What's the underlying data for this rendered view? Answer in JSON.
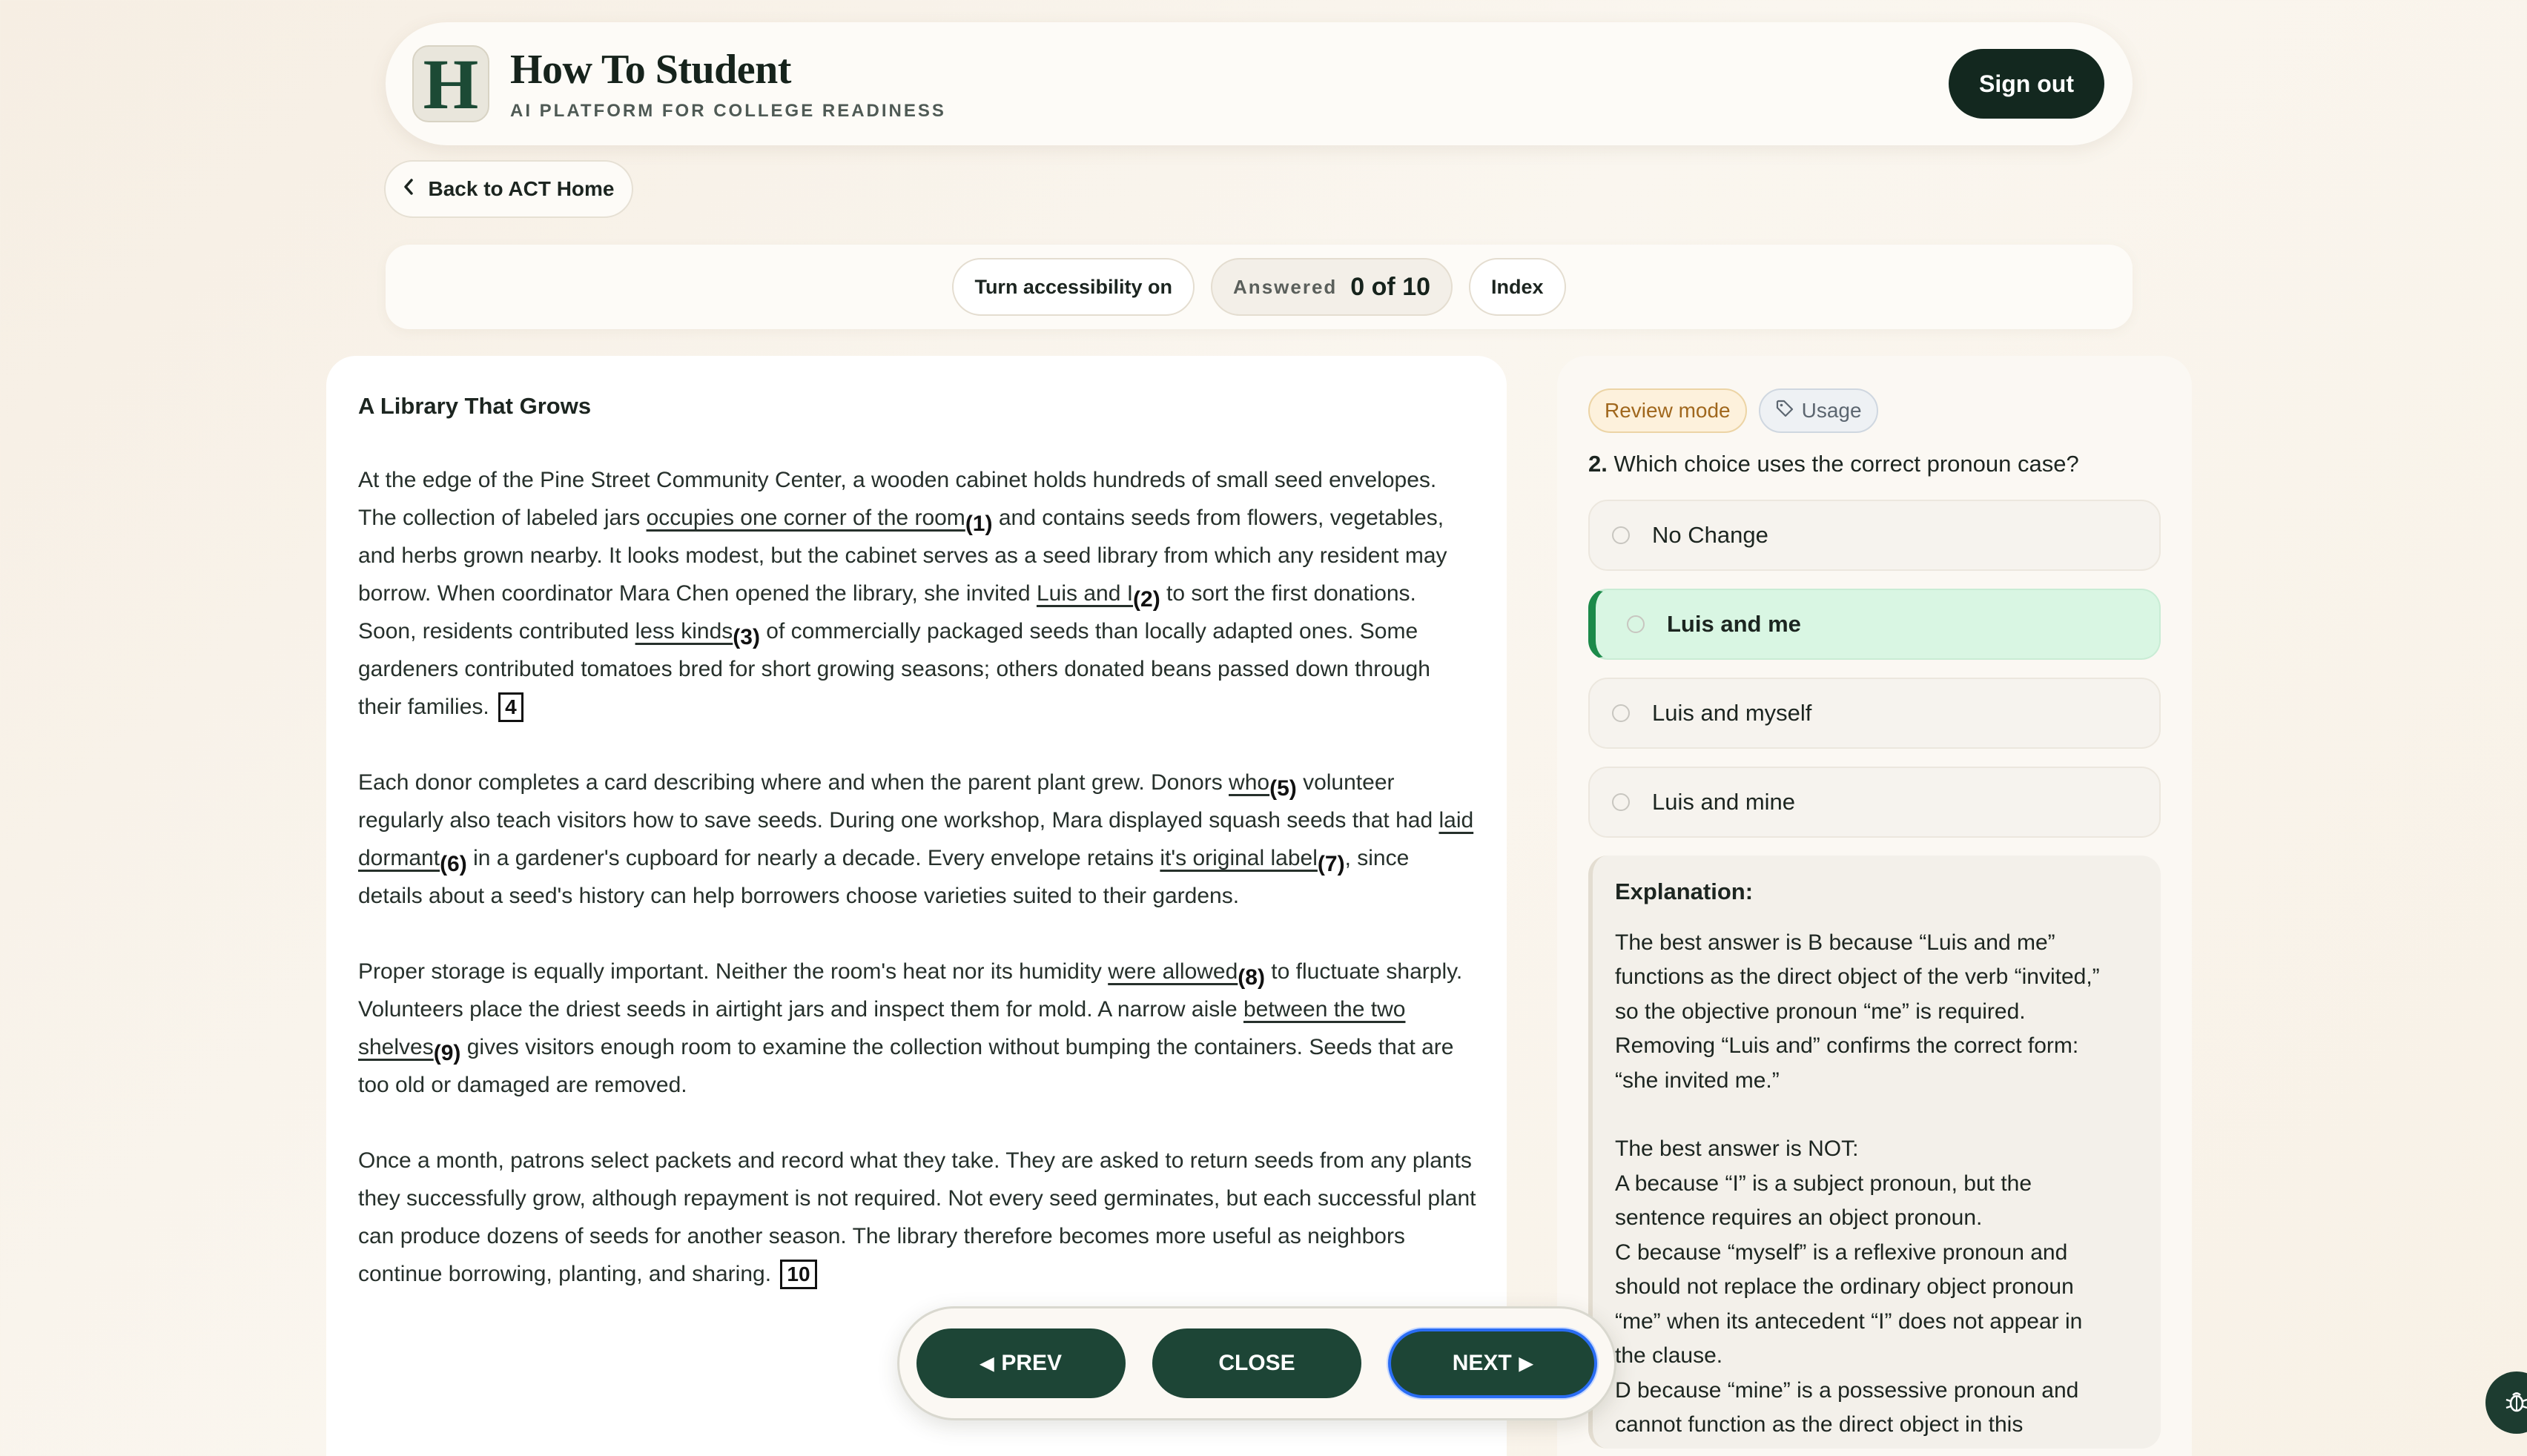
{
  "header": {
    "logo_letter": "H",
    "title": "How To Student",
    "subtitle": "AI PLATFORM FOR COLLEGE READINESS",
    "signout_label": "Sign out"
  },
  "back_button": {
    "label": "Back to ACT Home",
    "icon": "chevron-left-icon"
  },
  "toolbar": {
    "accessibility_label": "Turn accessibility on",
    "answered_label": "Answered",
    "answered_value": "0 of 10",
    "index_label": "Index"
  },
  "passage": {
    "title": "A Library That Grows",
    "paragraphs": [
      [
        {
          "t": "At the edge of the Pine Street Community Center, a wooden cabinet holds hundreds of small seed envelopes. The collection of labeled jars "
        },
        {
          "u": "occupies one corner of the room",
          "n": "(1)"
        },
        {
          "t": " and contains seeds from flowers, vegetables, and herbs grown nearby. It looks modest, but the cabinet serves as a seed library from which any resident may borrow. When coordinator Mara Chen opened the library, she invited "
        },
        {
          "u": "Luis and I",
          "n": "(2)"
        },
        {
          "t": " to sort the first donations. Soon, residents contributed "
        },
        {
          "u": "less kinds",
          "n": "(3)"
        },
        {
          "t": " of commercially packaged seeds than locally adapted ones. Some gardeners contributed tomatoes bred for short growing seasons; others donated beans passed down through their families. "
        },
        {
          "b": "4"
        }
      ],
      [
        {
          "t": "Each donor completes a card describing where and when the parent plant grew. Donors "
        },
        {
          "u": "who",
          "n": "(5)"
        },
        {
          "t": " volunteer regularly also teach visitors how to save seeds. During one workshop, Mara displayed squash seeds that had "
        },
        {
          "u": "laid dormant",
          "n": "(6)"
        },
        {
          "t": " in a gardener's cupboard for nearly a decade. Every envelope retains "
        },
        {
          "u": "it's original label",
          "n": "(7)"
        },
        {
          "t": ", since details about a seed's history can help borrowers choose varieties suited to their gardens."
        }
      ],
      [
        {
          "t": "Proper storage is equally important. Neither the room's heat nor its humidity "
        },
        {
          "u": "were allowed",
          "n": "(8)"
        },
        {
          "t": " to fluctuate sharply. Volunteers place the driest seeds in airtight jars and inspect them for mold. A narrow aisle "
        },
        {
          "u": "between the two shelves",
          "n": "(9)"
        },
        {
          "t": " gives visitors enough room to examine the collection without bumping the containers. Seeds that are too old or damaged are removed."
        }
      ],
      [
        {
          "t": "Once a month, patrons select packets and record what they take. They are asked to return seeds from any plants they successfully grow, although repayment is not required. Not every seed germinates, but each successful plant can produce dozens of seeds for another season. The library therefore becomes more useful as neighbors continue borrowing, planting, and sharing. "
        },
        {
          "b": "10"
        }
      ]
    ]
  },
  "question_panel": {
    "review_tag": "Review mode",
    "usage_tag": "Usage",
    "question_number": "2.",
    "question_text": "Which choice uses the correct pronoun case?",
    "choices": [
      "No Change",
      "Luis and me",
      "Luis and myself",
      "Luis and mine"
    ],
    "selected_index": 1,
    "explanation_title": "Explanation:",
    "explanation_lines": [
      "The best answer is B because “Luis and me”",
      "functions as the direct object of the verb “invited,”",
      "so the objective pronoun “me” is required.",
      "Removing “Luis and” confirms the correct form:",
      "“she invited me.”",
      "",
      "The best answer is NOT:",
      "A because “I” is a subject pronoun, but the",
      "sentence requires an object pronoun.",
      "C because “myself” is a reflexive pronoun and",
      "should not replace the ordinary object pronoun",
      "“me” when its antecedent “I” does not appear in",
      "the clause.",
      "D because “mine” is a possessive pronoun and",
      "cannot function as the direct object in this"
    ]
  },
  "nav": {
    "prev_label": "PREV",
    "close_label": "CLOSE",
    "next_label": "NEXT"
  },
  "colors": {
    "accent": "#1d4536",
    "selected_bg": "#d9f6e3",
    "selected_border": "#1c8a4a",
    "next_focus": "#2a6df4"
  }
}
